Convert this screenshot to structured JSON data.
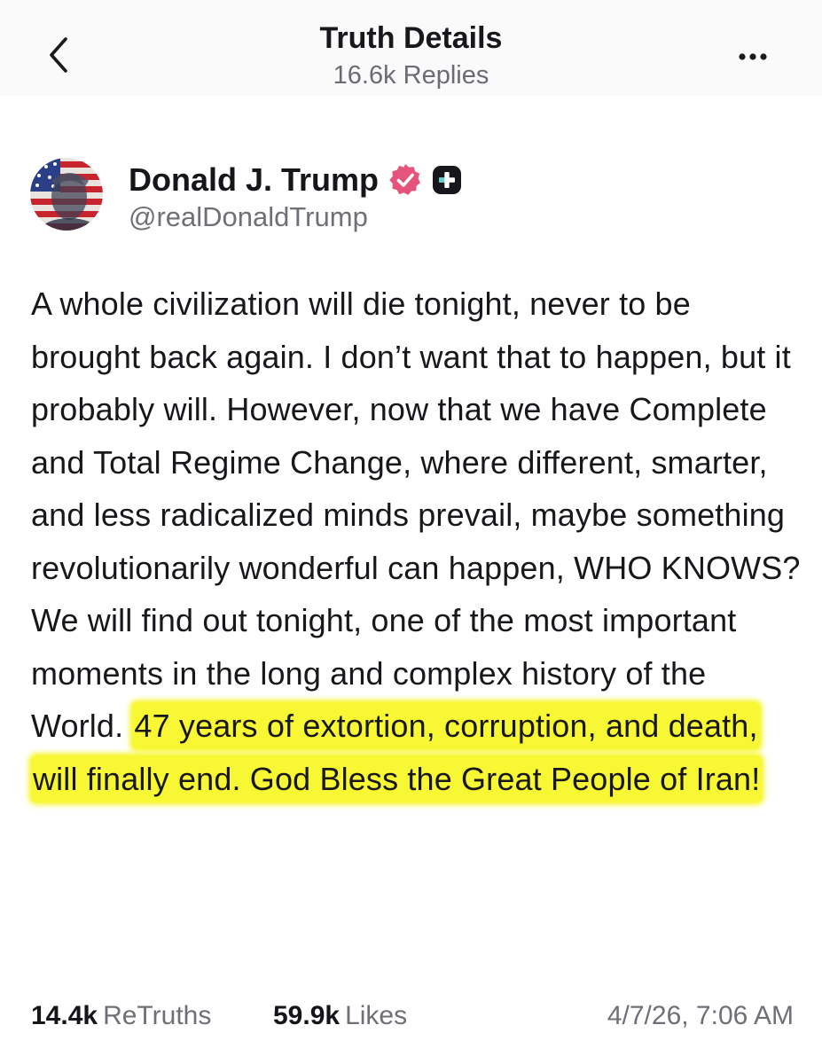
{
  "header": {
    "title": "Truth Details",
    "subtitle": "16.6k Replies",
    "back_icon": "chevron-left-icon",
    "more_icon": "more-horizontal-icon"
  },
  "post": {
    "author_name": "Donald J. Trump",
    "handle": "@realDonaldTrump",
    "verified_color": "#e5557b",
    "text_main": "A whole civilization will die tonight, never to be brought back again. I don’t want that to happen, but it probably will. However, now that we have Complete and Total Regime Change, where different, smarter, and less radicalized minds prevail, maybe something revolutionarily wonderful can happen, WHO KNOWS? We will find out tonight, one of the most important moments in the long and complex history of the World. ",
    "text_highlighted": "47 years of extortion, corruption, and death, will finally end. God Bless the Great People of Iran!",
    "highlight_color": "#f7f734"
  },
  "stats": {
    "retruths_count": "14.4k",
    "retruths_label": "ReTruths",
    "likes_count": "59.9k",
    "likes_label": "Likes",
    "timestamp": "4/7/26, 7:06 AM"
  }
}
